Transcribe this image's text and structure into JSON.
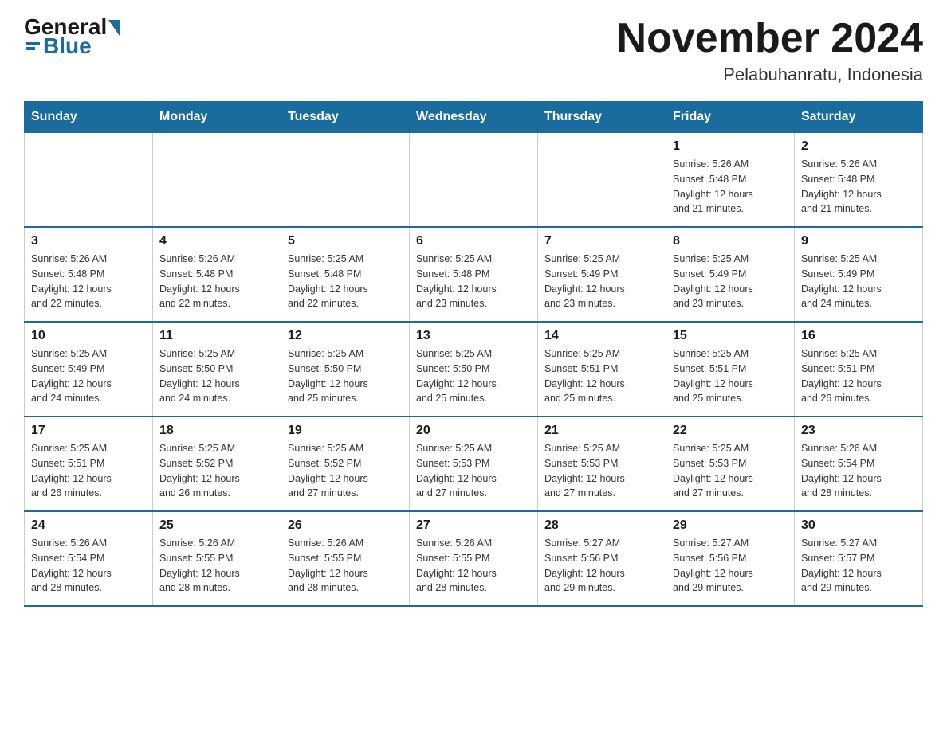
{
  "header": {
    "logo": {
      "general": "General",
      "blue": "Blue"
    },
    "title": "November 2024",
    "location": "Pelabuhanratu, Indonesia"
  },
  "weekdays": [
    "Sunday",
    "Monday",
    "Tuesday",
    "Wednesday",
    "Thursday",
    "Friday",
    "Saturday"
  ],
  "weeks": [
    [
      {
        "day": "",
        "info": ""
      },
      {
        "day": "",
        "info": ""
      },
      {
        "day": "",
        "info": ""
      },
      {
        "day": "",
        "info": ""
      },
      {
        "day": "",
        "info": ""
      },
      {
        "day": "1",
        "info": "Sunrise: 5:26 AM\nSunset: 5:48 PM\nDaylight: 12 hours\nand 21 minutes."
      },
      {
        "day": "2",
        "info": "Sunrise: 5:26 AM\nSunset: 5:48 PM\nDaylight: 12 hours\nand 21 minutes."
      }
    ],
    [
      {
        "day": "3",
        "info": "Sunrise: 5:26 AM\nSunset: 5:48 PM\nDaylight: 12 hours\nand 22 minutes."
      },
      {
        "day": "4",
        "info": "Sunrise: 5:26 AM\nSunset: 5:48 PM\nDaylight: 12 hours\nand 22 minutes."
      },
      {
        "day": "5",
        "info": "Sunrise: 5:25 AM\nSunset: 5:48 PM\nDaylight: 12 hours\nand 22 minutes."
      },
      {
        "day": "6",
        "info": "Sunrise: 5:25 AM\nSunset: 5:48 PM\nDaylight: 12 hours\nand 23 minutes."
      },
      {
        "day": "7",
        "info": "Sunrise: 5:25 AM\nSunset: 5:49 PM\nDaylight: 12 hours\nand 23 minutes."
      },
      {
        "day": "8",
        "info": "Sunrise: 5:25 AM\nSunset: 5:49 PM\nDaylight: 12 hours\nand 23 minutes."
      },
      {
        "day": "9",
        "info": "Sunrise: 5:25 AM\nSunset: 5:49 PM\nDaylight: 12 hours\nand 24 minutes."
      }
    ],
    [
      {
        "day": "10",
        "info": "Sunrise: 5:25 AM\nSunset: 5:49 PM\nDaylight: 12 hours\nand 24 minutes."
      },
      {
        "day": "11",
        "info": "Sunrise: 5:25 AM\nSunset: 5:50 PM\nDaylight: 12 hours\nand 24 minutes."
      },
      {
        "day": "12",
        "info": "Sunrise: 5:25 AM\nSunset: 5:50 PM\nDaylight: 12 hours\nand 25 minutes."
      },
      {
        "day": "13",
        "info": "Sunrise: 5:25 AM\nSunset: 5:50 PM\nDaylight: 12 hours\nand 25 minutes."
      },
      {
        "day": "14",
        "info": "Sunrise: 5:25 AM\nSunset: 5:51 PM\nDaylight: 12 hours\nand 25 minutes."
      },
      {
        "day": "15",
        "info": "Sunrise: 5:25 AM\nSunset: 5:51 PM\nDaylight: 12 hours\nand 25 minutes."
      },
      {
        "day": "16",
        "info": "Sunrise: 5:25 AM\nSunset: 5:51 PM\nDaylight: 12 hours\nand 26 minutes."
      }
    ],
    [
      {
        "day": "17",
        "info": "Sunrise: 5:25 AM\nSunset: 5:51 PM\nDaylight: 12 hours\nand 26 minutes."
      },
      {
        "day": "18",
        "info": "Sunrise: 5:25 AM\nSunset: 5:52 PM\nDaylight: 12 hours\nand 26 minutes."
      },
      {
        "day": "19",
        "info": "Sunrise: 5:25 AM\nSunset: 5:52 PM\nDaylight: 12 hours\nand 27 minutes."
      },
      {
        "day": "20",
        "info": "Sunrise: 5:25 AM\nSunset: 5:53 PM\nDaylight: 12 hours\nand 27 minutes."
      },
      {
        "day": "21",
        "info": "Sunrise: 5:25 AM\nSunset: 5:53 PM\nDaylight: 12 hours\nand 27 minutes."
      },
      {
        "day": "22",
        "info": "Sunrise: 5:25 AM\nSunset: 5:53 PM\nDaylight: 12 hours\nand 27 minutes."
      },
      {
        "day": "23",
        "info": "Sunrise: 5:26 AM\nSunset: 5:54 PM\nDaylight: 12 hours\nand 28 minutes."
      }
    ],
    [
      {
        "day": "24",
        "info": "Sunrise: 5:26 AM\nSunset: 5:54 PM\nDaylight: 12 hours\nand 28 minutes."
      },
      {
        "day": "25",
        "info": "Sunrise: 5:26 AM\nSunset: 5:55 PM\nDaylight: 12 hours\nand 28 minutes."
      },
      {
        "day": "26",
        "info": "Sunrise: 5:26 AM\nSunset: 5:55 PM\nDaylight: 12 hours\nand 28 minutes."
      },
      {
        "day": "27",
        "info": "Sunrise: 5:26 AM\nSunset: 5:55 PM\nDaylight: 12 hours\nand 28 minutes."
      },
      {
        "day": "28",
        "info": "Sunrise: 5:27 AM\nSunset: 5:56 PM\nDaylight: 12 hours\nand 29 minutes."
      },
      {
        "day": "29",
        "info": "Sunrise: 5:27 AM\nSunset: 5:56 PM\nDaylight: 12 hours\nand 29 minutes."
      },
      {
        "day": "30",
        "info": "Sunrise: 5:27 AM\nSunset: 5:57 PM\nDaylight: 12 hours\nand 29 minutes."
      }
    ]
  ]
}
